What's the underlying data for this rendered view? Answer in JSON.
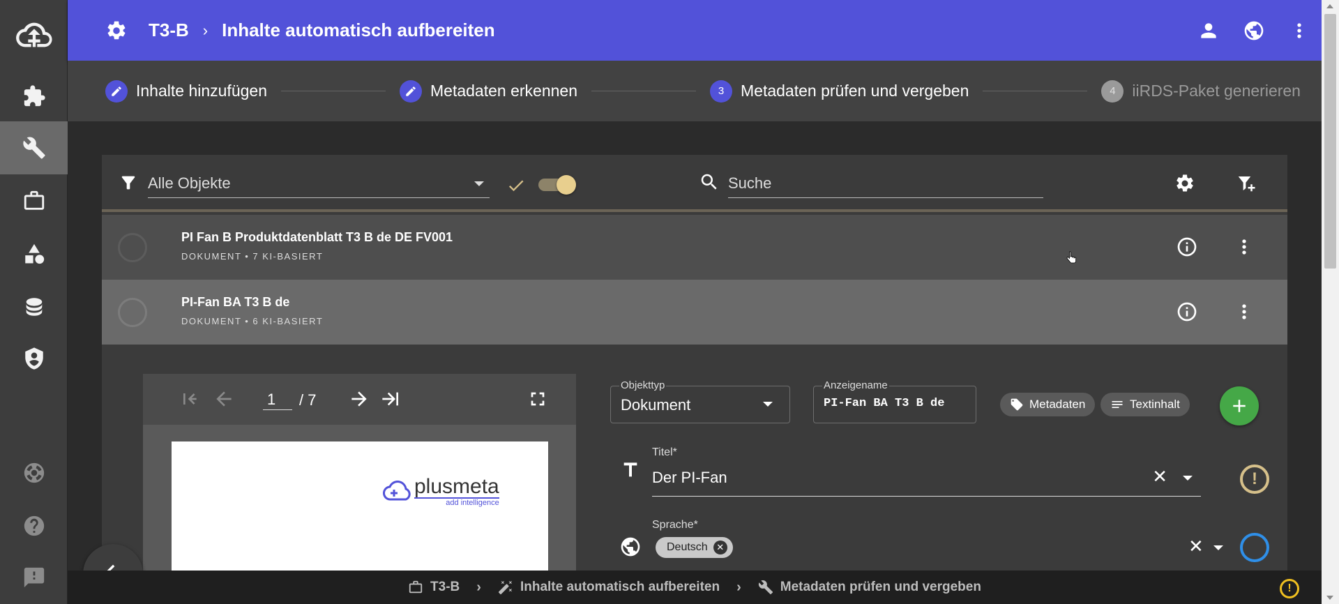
{
  "header": {
    "breadcrumb_project": "T3-B",
    "breadcrumb_separator": "›",
    "page_title": "Inhalte automatisch aufbereiten"
  },
  "stepper": {
    "steps": [
      {
        "label": "Inhalte hinzufügen",
        "state": "done"
      },
      {
        "label": "Metadaten erkennen",
        "state": "done"
      },
      {
        "number": "3",
        "label": "Metadaten prüfen und vergeben",
        "state": "active"
      },
      {
        "number": "4",
        "label": "iiRDS-Paket generieren",
        "state": "disabled"
      }
    ]
  },
  "filterbar": {
    "filter_value": "Alle Objekte",
    "search_placeholder": "Suche"
  },
  "list": {
    "rows": [
      {
        "title": "PI Fan B Produktdatenblatt T3 B de DE FV001",
        "subtitle": "DOKUMENT • 7 KI-BASIERT"
      },
      {
        "title": "PI-Fan BA T3 B de",
        "subtitle": "DOKUMENT • 6 KI-BASIERT"
      }
    ]
  },
  "viewer": {
    "current_page": "1",
    "total_pages": "/ 7",
    "logo_name": "plusmeta",
    "logo_tagline": "add intelligence"
  },
  "detail": {
    "objekttyp_label": "Objekttyp",
    "objekttyp_value": "Dokument",
    "anzeigename_label": "Anzeigename",
    "anzeigename_value": "PI-Fan BA T3 B de",
    "chip_metadaten": "Metadaten",
    "chip_textinhalt": "Textinhalt",
    "titel_label": "Titel*",
    "titel_value": "Der PI-Fan",
    "sprache_label": "Sprache*",
    "sprache_chip": "Deutsch",
    "warn_symbol": "!"
  },
  "statusbar": {
    "items": [
      {
        "label": "T3-B"
      },
      {
        "label": "Inhalte automatisch aufbereiten"
      },
      {
        "label": "Metadaten prüfen und vergeben"
      }
    ],
    "chevron": "›",
    "warn_symbol": "!"
  },
  "colors": {
    "brand_primary": "#5252d9",
    "accent_gold": "#d6c08a",
    "fab_green": "#45a847",
    "warn_yellow": "#f0c020"
  }
}
